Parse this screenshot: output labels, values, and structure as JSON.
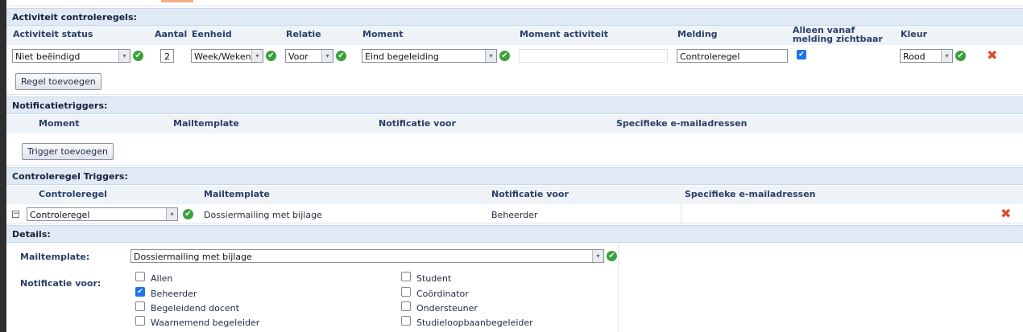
{
  "activiteit": {
    "section_title": "Activiteit controleregels:",
    "headers": {
      "status": "Activiteit status",
      "aantal": "Aantal",
      "eenheid": "Eenheid",
      "relatie": "Relatie",
      "moment": "Moment",
      "moment_activiteit": "Moment activiteit",
      "melding": "Melding",
      "alleen_vanaf": "Alleen vanaf melding zichtbaar",
      "kleur": "Kleur"
    },
    "row": {
      "status": "Niet beëindigd",
      "aantal": "2",
      "eenheid": "Week/Weken",
      "relatie": "Voor",
      "moment": "Eind begeleiding",
      "moment_activiteit": "",
      "melding": "Controleregel",
      "alleen_vanaf_checked": true,
      "kleur": "Rood"
    },
    "add_button": "Regel toevoegen"
  },
  "notificatie": {
    "section_title": "Notificatietriggers:",
    "headers": {
      "moment": "Moment",
      "mailtemplate": "Mailtemplate",
      "notificatie_voor": "Notificatie voor",
      "emails": "Specifieke e-mailadressen"
    },
    "add_button": "Trigger toevoegen"
  },
  "controleregel_triggers": {
    "section_title": "Controleregel Triggers:",
    "headers": {
      "controleregel": "Controleregel",
      "mailtemplate": "Mailtemplate",
      "notificatie_voor": "Notificatie voor",
      "emails": "Specifieke e-mailadressen"
    },
    "row": {
      "controleregel": "Controleregel",
      "mailtemplate": "Dossiermailing met bijlage",
      "notificatie_voor": "Beheerder",
      "collapse_symbol": "−"
    }
  },
  "details": {
    "section_title": "Details:",
    "mailtemplate_label": "Mailtemplate:",
    "mailtemplate_value": "Dossiermailing met bijlage",
    "notificatie_label": "Notificatie voor:",
    "options_left": [
      {
        "label": "Allen",
        "checked": false
      },
      {
        "label": "Beheerder",
        "checked": true
      },
      {
        "label": "Begeleidend docent",
        "checked": false
      },
      {
        "label": "Waarnemend begeleider",
        "checked": false
      }
    ],
    "options_right": [
      {
        "label": "Student",
        "checked": false
      },
      {
        "label": "Coördinator",
        "checked": false
      },
      {
        "label": "Ondersteuner",
        "checked": false
      },
      {
        "label": "Studieloopbaanbegeleider",
        "checked": false
      }
    ]
  },
  "icons": {
    "ok": "✔",
    "delete": "✖",
    "dropdown": "▾",
    "check": "✔"
  },
  "colors": {
    "section_bg": "#dfeaf5",
    "ok_green": "#3aa13a",
    "delete_red": "#e14b2a",
    "checkbox_blue": "#1e73e8"
  }
}
